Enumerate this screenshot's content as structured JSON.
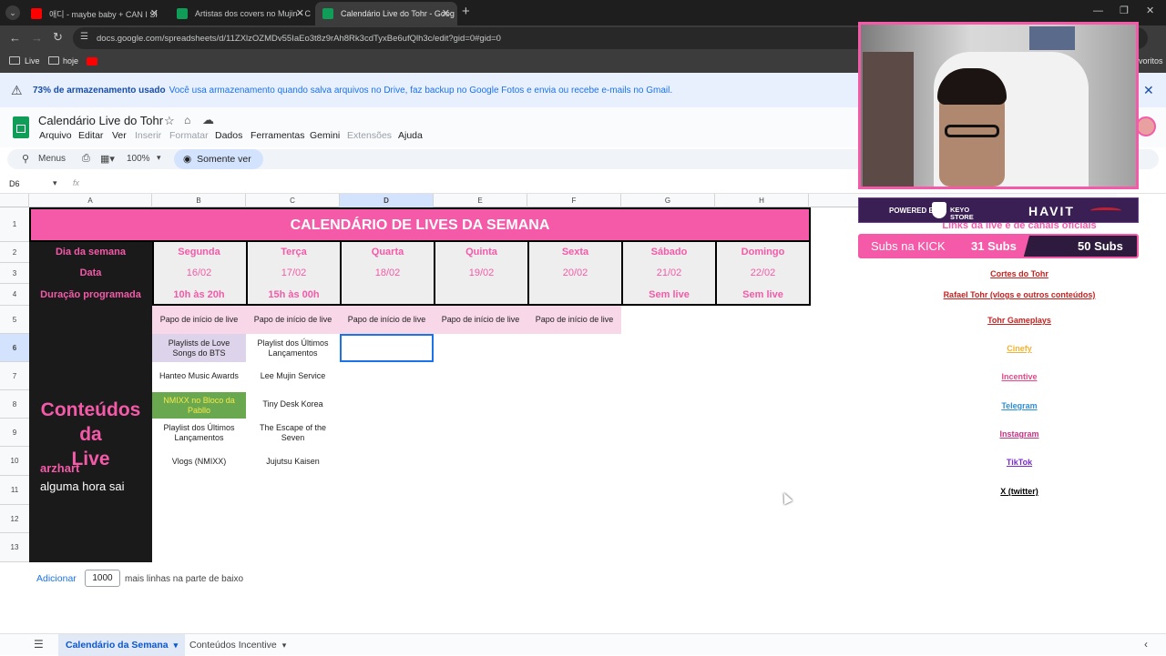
{
  "browser": {
    "tabs": [
      {
        "label": "애디 - maybe baby + CAN I SI",
        "icon": "youtube-icon",
        "active": false
      },
      {
        "label": "Artistas dos covers no Mujin - C",
        "icon": "sheets-icon",
        "active": false
      },
      {
        "label": "Calendário Live do Tohr - Goog",
        "icon": "sheets-icon",
        "active": true
      }
    ],
    "url": "docs.google.com/spreadsheets/d/11ZXlzOZMDv55IaEo3t8z9rAh8Rk3cdTyxBe6ufQlh3c/edit?gid=0#gid=0",
    "bookmarks": [
      "Live",
      "hoje"
    ],
    "bookmarks_right": "voritos"
  },
  "banner": {
    "bold": "73% de armazenamento usado",
    "text": "Você usa armazenamento quando salva arquivos no Drive, faz backup no Google Fotos e envia ou recebe e-mails no Gmail."
  },
  "doc": {
    "title": "Calendário Live do Tohr",
    "menus": [
      "Arquivo",
      "Editar",
      "Ver",
      "Inserir",
      "Formatar",
      "Dados",
      "Ferramentas",
      "Gemini",
      "Extensões",
      "Ajuda"
    ],
    "disabled_menus": [
      "Inserir",
      "Formatar",
      "Extensões"
    ]
  },
  "toolbar": {
    "search": "Menus",
    "zoom": "100%",
    "mode": "Somente ver"
  },
  "formula_bar": {
    "cell_ref": "D6",
    "fx": "fx"
  },
  "columns": [
    "A",
    "B",
    "C",
    "D",
    "E",
    "F",
    "G",
    "H"
  ],
  "rows": [
    "1",
    "2",
    "3",
    "4",
    "5",
    "6",
    "7",
    "8",
    "9",
    "10",
    "11",
    "12",
    "13"
  ],
  "calendar": {
    "title": "CALENDÁRIO DE LIVES DA SEMANA",
    "row_labels": [
      "Dia da semana",
      "Data",
      "Duração programada"
    ],
    "days": [
      {
        "name": "Segunda",
        "date": "16/02",
        "duration": "10h às 20h"
      },
      {
        "name": "Terça",
        "date": "17/02",
        "duration": "15h às 00h"
      },
      {
        "name": "Quarta",
        "date": "18/02",
        "duration": ""
      },
      {
        "name": "Quinta",
        "date": "19/02",
        "duration": ""
      },
      {
        "name": "Sexta",
        "date": "20/02",
        "duration": ""
      },
      {
        "name": "Sábado",
        "date": "21/02",
        "duration": "Sem live"
      },
      {
        "name": "Domingo",
        "date": "22/02",
        "duration": "Sem live"
      }
    ],
    "papo": "Papo de início de live",
    "contents_title_1": "Conteúdos",
    "contents_title_2": "da",
    "contents_title_3": "Live",
    "contents_small": "arzhart",
    "contents_note": "alguma hora sai",
    "segunda_items": [
      "Playlists de Love Songs do BTS",
      "Hanteo Music Awards",
      "NMIXX no Bloco da Pabllo",
      "Playlist dos Últimos Lançamentos",
      "Vlogs (NMIXX)"
    ],
    "terca_items": [
      "Playlist dos Últimos Lançamentos",
      "Lee Mujin Service",
      "Tiny Desk Korea",
      "The Escape of the Seven",
      "Jujutsu Kaisen"
    ]
  },
  "links": {
    "header": "Links da live e de canais oficiais",
    "items": [
      {
        "label": "Cortes do Tohr",
        "color": "#c5221f"
      },
      {
        "label": "Rafael Tohr (vlogs e outros conteúdos)",
        "color": "#c5221f"
      },
      {
        "label": "Tohr Gameplays",
        "color": "#c5221f"
      },
      {
        "label": "Cinefy",
        "color": "#f2b233"
      },
      {
        "label": "Incentive",
        "color": "#e24a8a"
      },
      {
        "label": "Telegram",
        "color": "#2f8fd5"
      },
      {
        "label": "Instagram",
        "color": "#c13584"
      },
      {
        "label": "TikTok",
        "color": "#7b2ccf"
      },
      {
        "label": "X (twitter)",
        "color": "#000000"
      }
    ]
  },
  "overlay": {
    "powered": "POWERED BY",
    "sponsor": "KEYO STORE",
    "brand": "HAVIT",
    "subs_label": "Subs na KICK",
    "subs_current": "31 Subs",
    "subs_goal": "50 Subs"
  },
  "footer": {
    "add": "Adicionar",
    "count": "1000",
    "more": "mais linhas na parte de baixo"
  },
  "sheets": [
    "Calendário da Semana",
    "Conteúdos Incentive"
  ]
}
